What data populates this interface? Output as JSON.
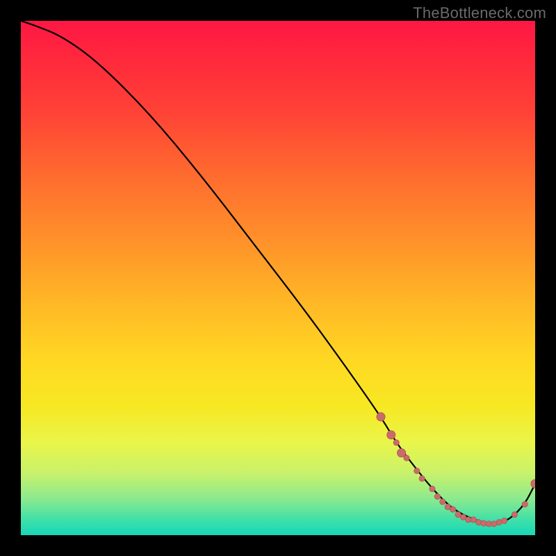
{
  "attribution": "TheBottleneck.com",
  "chart_data": {
    "type": "line",
    "title": "",
    "xlabel": "",
    "ylabel": "",
    "xlim": [
      0,
      100
    ],
    "ylim": [
      0,
      100
    ],
    "grid": false,
    "legend": false,
    "background_gradient": {
      "direction": "vertical",
      "stops": [
        {
          "pos": 0,
          "color": "#ff1744"
        },
        {
          "pos": 50,
          "color": "#ffd823"
        },
        {
          "pos": 100,
          "color": "#17d8b8"
        }
      ],
      "meaning": "top=high bottleneck (red), bottom=low bottleneck (green)"
    },
    "series": [
      {
        "name": "bottleneck-curve",
        "x": [
          0,
          3,
          8,
          15,
          25,
          35,
          45,
          55,
          63,
          70,
          73,
          76,
          80,
          84,
          88,
          92,
          95,
          98,
          100
        ],
        "y": [
          100,
          99,
          97,
          92,
          82,
          70,
          57,
          44,
          33,
          23,
          18,
          14,
          9,
          5,
          3,
          2,
          3,
          6,
          10
        ]
      }
    ],
    "markers": {
      "name": "highlighted-range",
      "comment": "red/coral dots clustered near the minimum of the curve",
      "points_large": [
        {
          "x": 70,
          "y": 23
        },
        {
          "x": 72,
          "y": 19.5
        },
        {
          "x": 74,
          "y": 16
        },
        {
          "x": 100,
          "y": 10
        }
      ],
      "points_small": [
        {
          "x": 73,
          "y": 18
        },
        {
          "x": 75,
          "y": 15
        },
        {
          "x": 77,
          "y": 12.5
        },
        {
          "x": 78,
          "y": 11
        },
        {
          "x": 80,
          "y": 9
        },
        {
          "x": 81,
          "y": 7.5
        },
        {
          "x": 82,
          "y": 6.5
        },
        {
          "x": 83,
          "y": 5.5
        },
        {
          "x": 84,
          "y": 5
        },
        {
          "x": 85,
          "y": 4
        },
        {
          "x": 86,
          "y": 3.5
        },
        {
          "x": 87,
          "y": 3
        },
        {
          "x": 88,
          "y": 3
        },
        {
          "x": 89,
          "y": 2.5
        },
        {
          "x": 90,
          "y": 2.3
        },
        {
          "x": 91,
          "y": 2.2
        },
        {
          "x": 92,
          "y": 2.2
        },
        {
          "x": 93,
          "y": 2.5
        },
        {
          "x": 94,
          "y": 2.8
        },
        {
          "x": 96,
          "y": 4
        },
        {
          "x": 98,
          "y": 6
        }
      ]
    }
  }
}
